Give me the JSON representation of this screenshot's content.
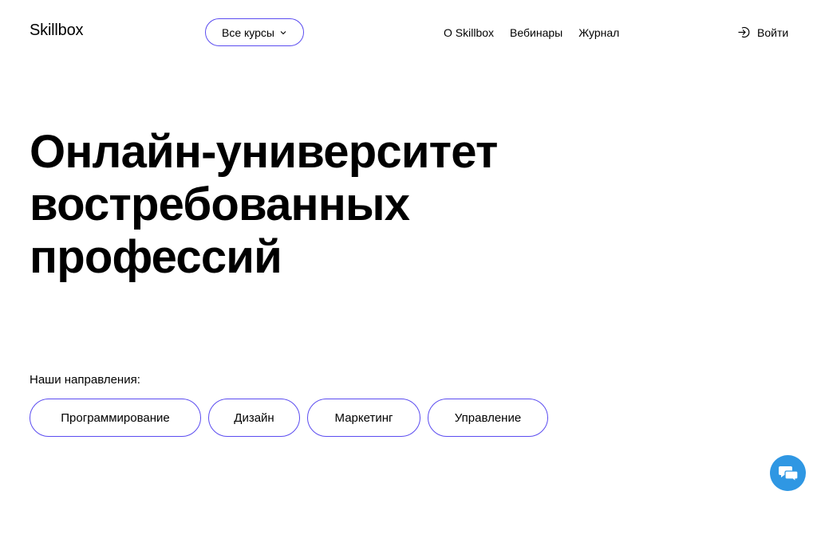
{
  "header": {
    "logo": "Skillbox",
    "all_courses_label": "Все курсы",
    "nav": [
      {
        "label": "О Skillbox"
      },
      {
        "label": "Вебинары"
      },
      {
        "label": "Журнал"
      }
    ],
    "login_label": "Войти"
  },
  "hero": {
    "title_lines": [
      "Онлайн-университет",
      "востребованных",
      "профессий"
    ]
  },
  "directions": {
    "label": "Наши направления:",
    "items": [
      {
        "label": "Программирование"
      },
      {
        "label": "Дизайн"
      },
      {
        "label": "Маркетинг"
      },
      {
        "label": "Управление"
      }
    ]
  },
  "colors": {
    "accent": "#5b4cf0",
    "chat": "#2f97e3"
  },
  "icons": {
    "all_courses": "chevron-down-icon",
    "login": "login-arrow-icon",
    "chat": "chat-bubbles-icon"
  }
}
